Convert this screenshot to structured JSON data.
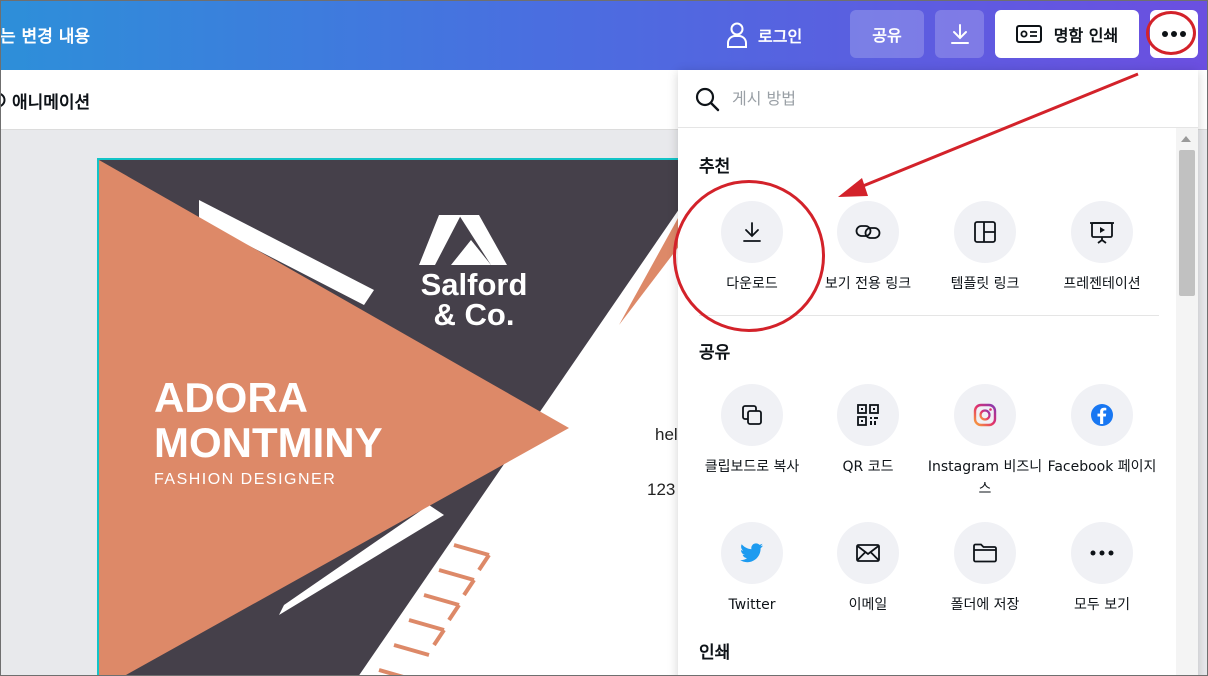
{
  "topbar": {
    "title": "는 변경 내용",
    "login_label": "로그인",
    "share_label": "공유",
    "print_label": "명함 인쇄",
    "more_icon": "more-icon",
    "gradient": [
      "#2d8fd9",
      "#6b4fe0"
    ]
  },
  "subbar": {
    "animation_label": "애니메이션"
  },
  "design": {
    "brand_line1": "Salford",
    "brand_line2": "& Co.",
    "name_line1": "ADORA",
    "name_line2": "MONTMINY",
    "role": "FASHION DESIGNER",
    "email_partial": "hel",
    "phone_partial": "123",
    "colors": {
      "orange": "#dd8968",
      "dark": "#45404a"
    }
  },
  "panel": {
    "search_placeholder": "게시 방법",
    "sections": [
      {
        "title": "추천",
        "items": [
          {
            "label": "다운로드",
            "icon": "download-icon"
          },
          {
            "label": "보기 전용 링크",
            "icon": "link-icon"
          },
          {
            "label": "템플릿 링크",
            "icon": "template-icon"
          },
          {
            "label": "프레젠테이션",
            "icon": "presentation-icon"
          }
        ]
      },
      {
        "title": "공유",
        "items": [
          {
            "label": "클립보드로 복사",
            "icon": "copy-icon"
          },
          {
            "label": "QR 코드",
            "icon": "qr-code-icon"
          },
          {
            "label": "Instagram 비즈니스",
            "icon": "instagram-icon"
          },
          {
            "label": "Facebook 페이지",
            "icon": "facebook-icon"
          },
          {
            "label": "Twitter",
            "icon": "twitter-icon"
          },
          {
            "label": "이메일",
            "icon": "email-icon"
          },
          {
            "label": "폴더에 저장",
            "icon": "folder-icon"
          },
          {
            "label": "모두 보기",
            "icon": "more-icon"
          }
        ]
      },
      {
        "title": "인쇄",
        "items": []
      }
    ]
  },
  "annotation_color": "#d3222a"
}
